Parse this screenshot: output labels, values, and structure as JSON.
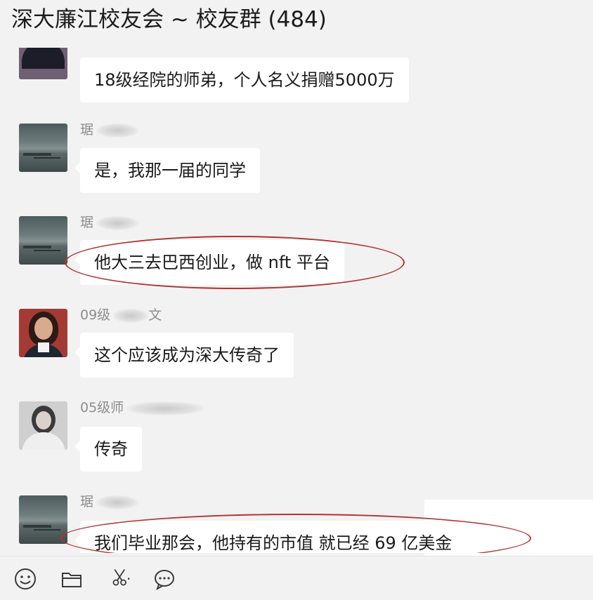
{
  "header": {
    "title": "深大廉江校友会 ~ 校友群 (484)"
  },
  "messages": [
    {
      "sender": "",
      "avatar": "suit-avatar",
      "text": "18级经院的师弟，个人名义捐赠5000万"
    },
    {
      "sender": "琚",
      "avatar": "sea-avatar",
      "text": "是，我那一届的同学"
    },
    {
      "sender": "琚",
      "avatar": "sea-avatar",
      "text": "他大三去巴西创业，做 nft 平台"
    },
    {
      "sender": "09级",
      "sender_suffix": "文",
      "avatar": "woman-avatar",
      "text": "这个应该成为深大传奇了"
    },
    {
      "sender": "05级师",
      "avatar": "gray-avatar",
      "text": "传奇"
    },
    {
      "sender": "琚",
      "avatar": "sea-avatar",
      "text": "我们毕业那会，他持有的市值 就已经 69 亿美金"
    }
  ],
  "annotations": {
    "color": "#b3322f"
  },
  "toolbar": {
    "icons": [
      "emoji-icon",
      "folder-icon",
      "scissors-icon",
      "chat-bubble-icon"
    ],
    "scissors_suffix": "·"
  }
}
